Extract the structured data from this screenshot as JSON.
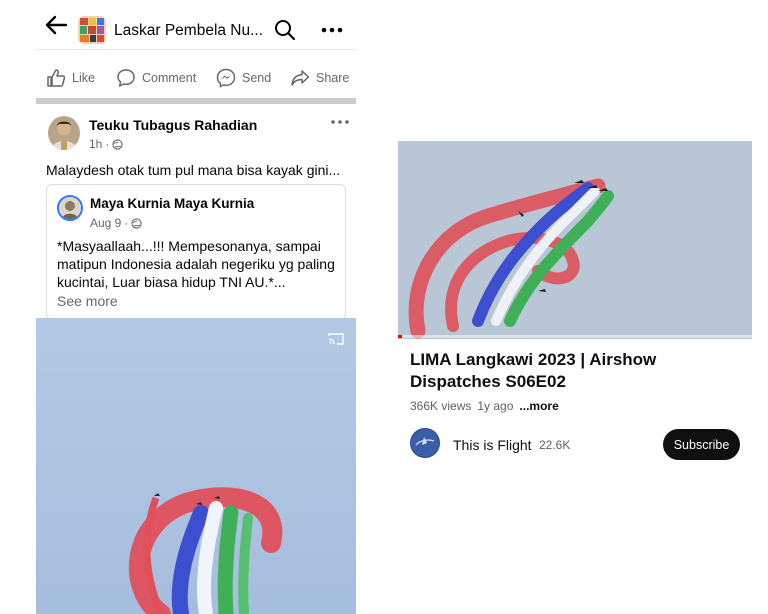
{
  "facebook": {
    "header": {
      "group_name": "Laskar Pembela Nu...",
      "icons": [
        "back-arrow-icon",
        "search-icon",
        "more-horizontal-icon"
      ]
    },
    "actions": {
      "like": "Like",
      "comment": "Comment",
      "send": "Send",
      "share": "Share"
    },
    "post": {
      "author": "Teuku Tubagus Rahadian",
      "time": "1h",
      "separator": "·",
      "privacy_icon": "globe-icon",
      "text": "Malaydesh otak tum pul mana bisa kayak gini...",
      "shared": {
        "author": "Maya Kurnia Maya Kurnia",
        "date": "Aug 9",
        "separator": "·",
        "text": "*Masyaallaah...!!! Mempesonanya, sampai matipun Indonesia adalah negeriku yg paling kucintai, Luar biasa hidup TNI AU.*...",
        "see_more": "See more"
      }
    },
    "video": {
      "cast_icon": "cast-icon"
    }
  },
  "youtube": {
    "title": "LIMA Langkawi 2023 | Airshow Dispatches S06E02",
    "views": "366K views",
    "age": "1y ago",
    "more": "...more",
    "channel_name": "This is Flight",
    "subscribers": "22.6K",
    "subscribe_label": "Subscribe",
    "progress_fraction": 0.01
  },
  "colors": {
    "fb_text": "#050505",
    "fb_secondary": "#65676b",
    "fb_divider": "#c9ccd1",
    "shared_ring": "#2e7cf6",
    "yt_text": "#0f0f0f",
    "yt_secondary": "#606060",
    "smoke_red": "#e0505a",
    "smoke_blue": "#3b4fd0",
    "smoke_green": "#3fb058"
  }
}
